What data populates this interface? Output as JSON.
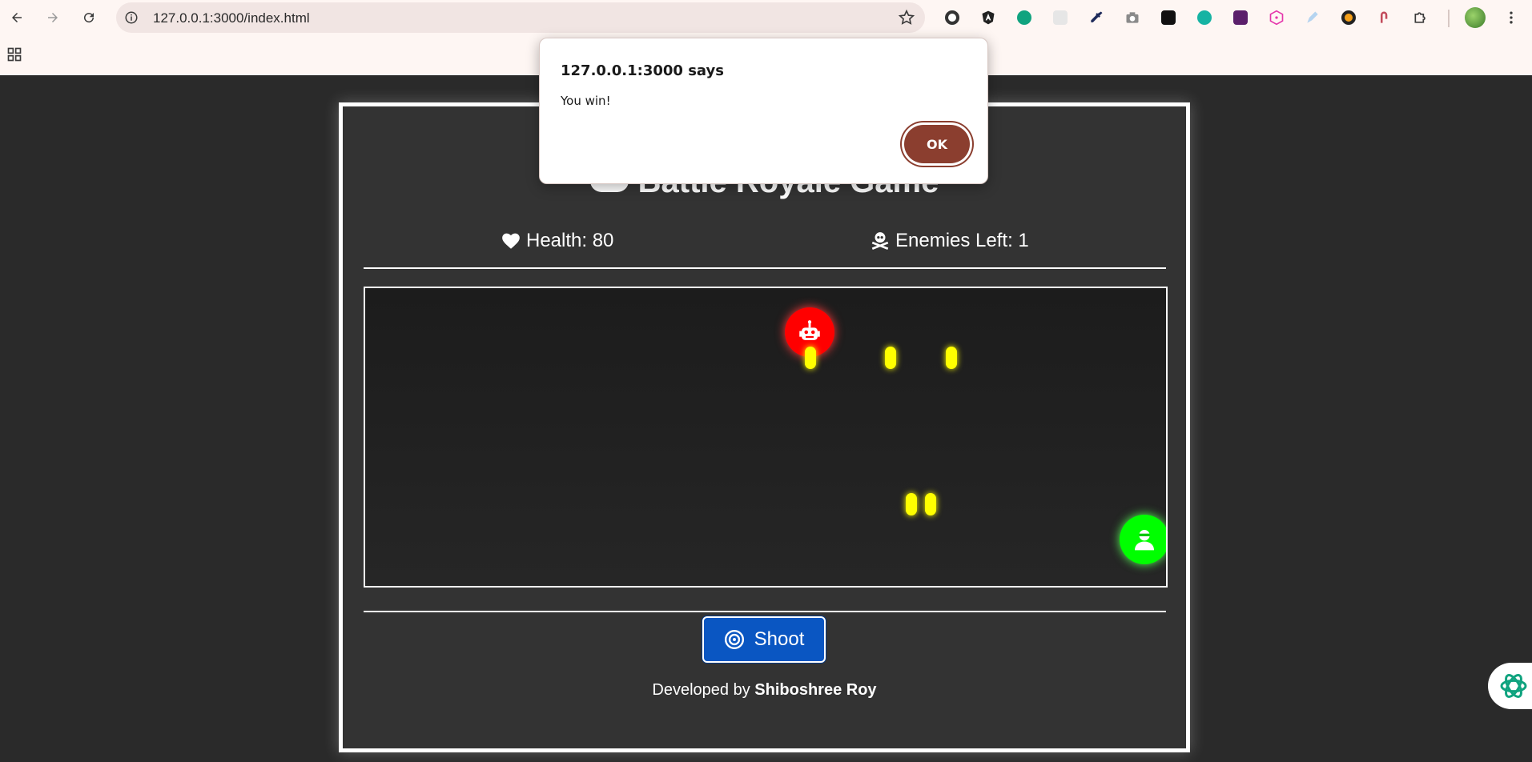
{
  "browser": {
    "url": "127.0.0.1:3000/index.html",
    "extensions": [
      "grammarly-icon",
      "angular-icon",
      "chatgpt-icon",
      "generic-extension-icon",
      "eyedropper-icon",
      "camera-icon",
      "notion-icon",
      "refresh-extension-icon",
      "purple-extension-icon",
      "graphql-icon",
      "pen-extension-icon",
      "record-icon",
      "cursor-extension-icon",
      "puzzle-icon",
      "avatar"
    ]
  },
  "game": {
    "title": "Battle Royale Game",
    "health_label": "Health: 80",
    "enemies_label": "Enemies Left: 1",
    "shoot_label": "Shoot",
    "footer_prefix": "Developed by ",
    "footer_author": "Shiboshree Roy"
  },
  "dialog": {
    "title": "127.0.0.1:3000 says",
    "message": "You win!",
    "ok_label": "OK"
  },
  "colors": {
    "enemy": "#ff0000",
    "player": "#00ff00",
    "bullet": "#ffff00",
    "shoot_button": "#0a56c2",
    "ok_button": "#8b3e2f"
  }
}
